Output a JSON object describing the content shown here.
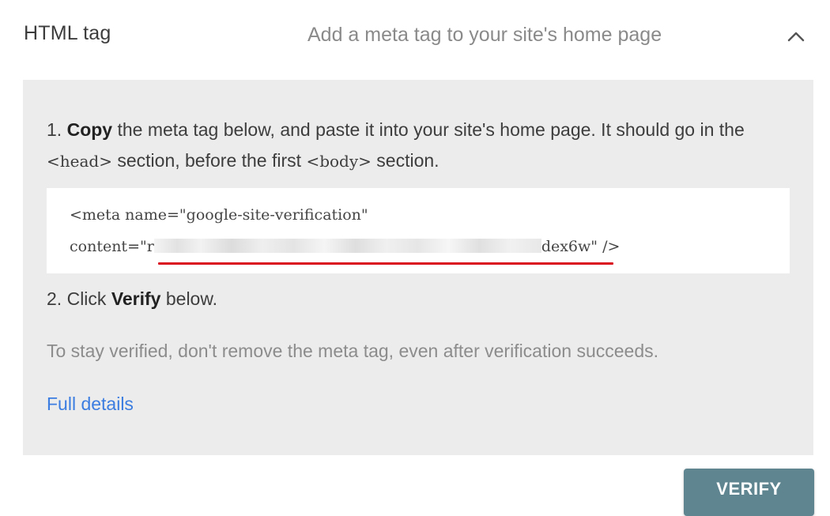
{
  "header": {
    "title": "HTML tag",
    "description": "Add a meta tag to your site's home page",
    "toggle_icon": "chevron-up-icon"
  },
  "instructions": {
    "step1": {
      "number": "1.",
      "bold": "Copy",
      "text_a": "the meta tag below, and paste it into your site's home page. It should go in the",
      "tag_head": "<head>",
      "text_b": "section, before the first",
      "tag_body": "<body>",
      "text_c": "section."
    },
    "code": {
      "line1": "<meta name=\"google-site-verification\"",
      "line2_prefix": "content=\"r",
      "line2_suffix": "dex6w\" />"
    },
    "step2": {
      "number": "2.",
      "text_a": "Click",
      "bold": "Verify",
      "text_b": "below."
    },
    "note": "To stay verified, don't remove the meta tag, even after verification succeeds.",
    "link": "Full details"
  },
  "actions": {
    "verify_label": "VERIFY"
  },
  "colors": {
    "panel_bg": "#ececec",
    "link": "#3b7de0",
    "button_bg": "#5f8591",
    "underline": "#d90d1e"
  }
}
